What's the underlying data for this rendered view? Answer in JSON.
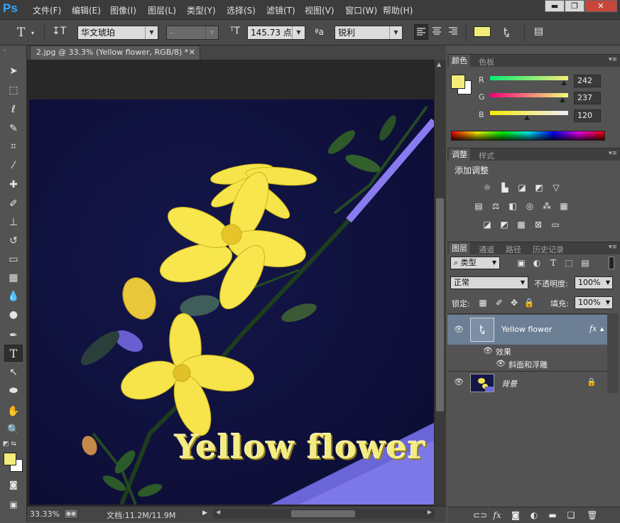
{
  "app": {
    "logo": "Ps",
    "menu": [
      "文件(F)",
      "编辑(E)",
      "图像(I)",
      "图层(L)",
      "类型(Y)",
      "选择(S)",
      "滤镜(T)",
      "视图(V)",
      "窗口(W)",
      "帮助(H)"
    ],
    "window_buttons": [
      "▬",
      "❐",
      "✕"
    ]
  },
  "options": {
    "font_family": "华文琥珀",
    "font_style": "-",
    "font_size": "145.73 点",
    "aa_label": "ªa",
    "anti_alias": "锐利",
    "text_color": "#f2ed78"
  },
  "document": {
    "tab_title": "2.jpg @ 33.3% (Yellow flower, RGB/8) *",
    "close": "✕",
    "canvas_text": "Yellow flower",
    "zoom": "33.33%",
    "doc_size": "文档:11.2M/11.9M"
  },
  "color_panel": {
    "tabs": [
      "颜色",
      "色板"
    ],
    "fg": "#f2ed78",
    "channels": [
      {
        "label": "R",
        "value": "242",
        "fraction": 0.949
      },
      {
        "label": "G",
        "value": "237",
        "fraction": 0.929
      },
      {
        "label": "B",
        "value": "120",
        "fraction": 0.471
      }
    ]
  },
  "adjust_panel": {
    "tabs": [
      "调整",
      "样式"
    ],
    "heading": "添加调整"
  },
  "layers_panel": {
    "tabs": [
      "图层",
      "通道",
      "路径",
      "历史记录"
    ],
    "filter": "类型",
    "blend_mode": "正常",
    "opacity_label": "不透明度:",
    "opacity": "100%",
    "lock_label": "锁定:",
    "fill_label": "填充:",
    "fill": "100%",
    "layers": [
      {
        "name": "Yellow flower",
        "fx": "fx",
        "effects_label": "效果",
        "effect": "斜面和浮雕"
      },
      {
        "name": "背景"
      }
    ]
  }
}
